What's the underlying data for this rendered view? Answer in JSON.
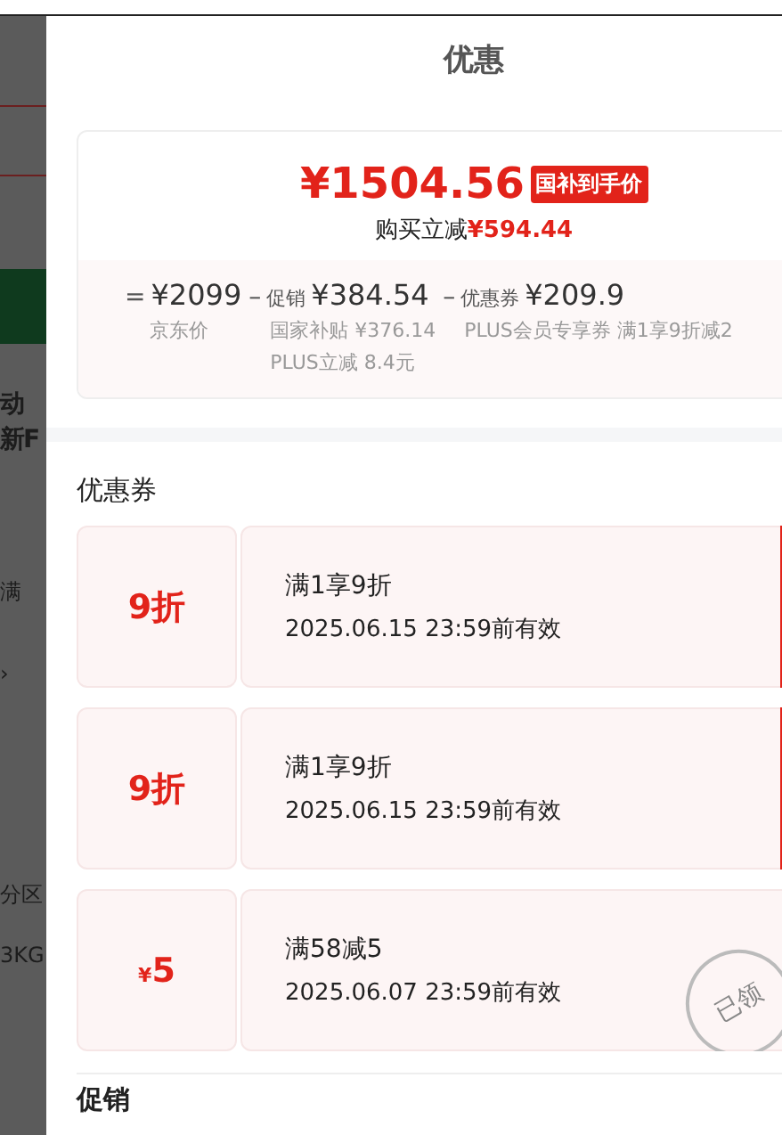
{
  "background_page": {
    "texts": [
      "动",
      "新F",
      "满",
      "›",
      "分区",
      "3KG"
    ]
  },
  "drawer": {
    "title": "优惠",
    "summary": {
      "price": "¥1504.56",
      "price_tag": "国补到手价",
      "saving_label": "购买立减",
      "saving": "¥594.44",
      "breakdown": [
        {
          "sign": "=",
          "amount": "¥2099",
          "details": [
            "京东价"
          ]
        },
        {
          "sign": "–",
          "label": "促销",
          "amount": "¥384.54",
          "details": [
            "国家补贴 ¥376.14",
            "PLUS立减 8.4元"
          ]
        },
        {
          "sign": "–",
          "label": "优惠券",
          "amount": "¥209.9",
          "details": [
            "PLUS会员专享券 满1享9折减2"
          ]
        }
      ]
    },
    "coupons_title": "优惠券",
    "coupons": [
      {
        "value": "9折",
        "title": "满1享9折",
        "validity": "2025.06.15 23:59前有效",
        "claimed": false
      },
      {
        "value": "9折",
        "title": "满1享9折",
        "validity": "2025.06.15 23:59前有效",
        "claimed": false
      },
      {
        "currency": "¥",
        "value": "5",
        "title": "满58减5",
        "validity": "2025.06.07 23:59前有效",
        "claimed": true,
        "stamp": "已领"
      }
    ],
    "next_section_title": "促销"
  }
}
